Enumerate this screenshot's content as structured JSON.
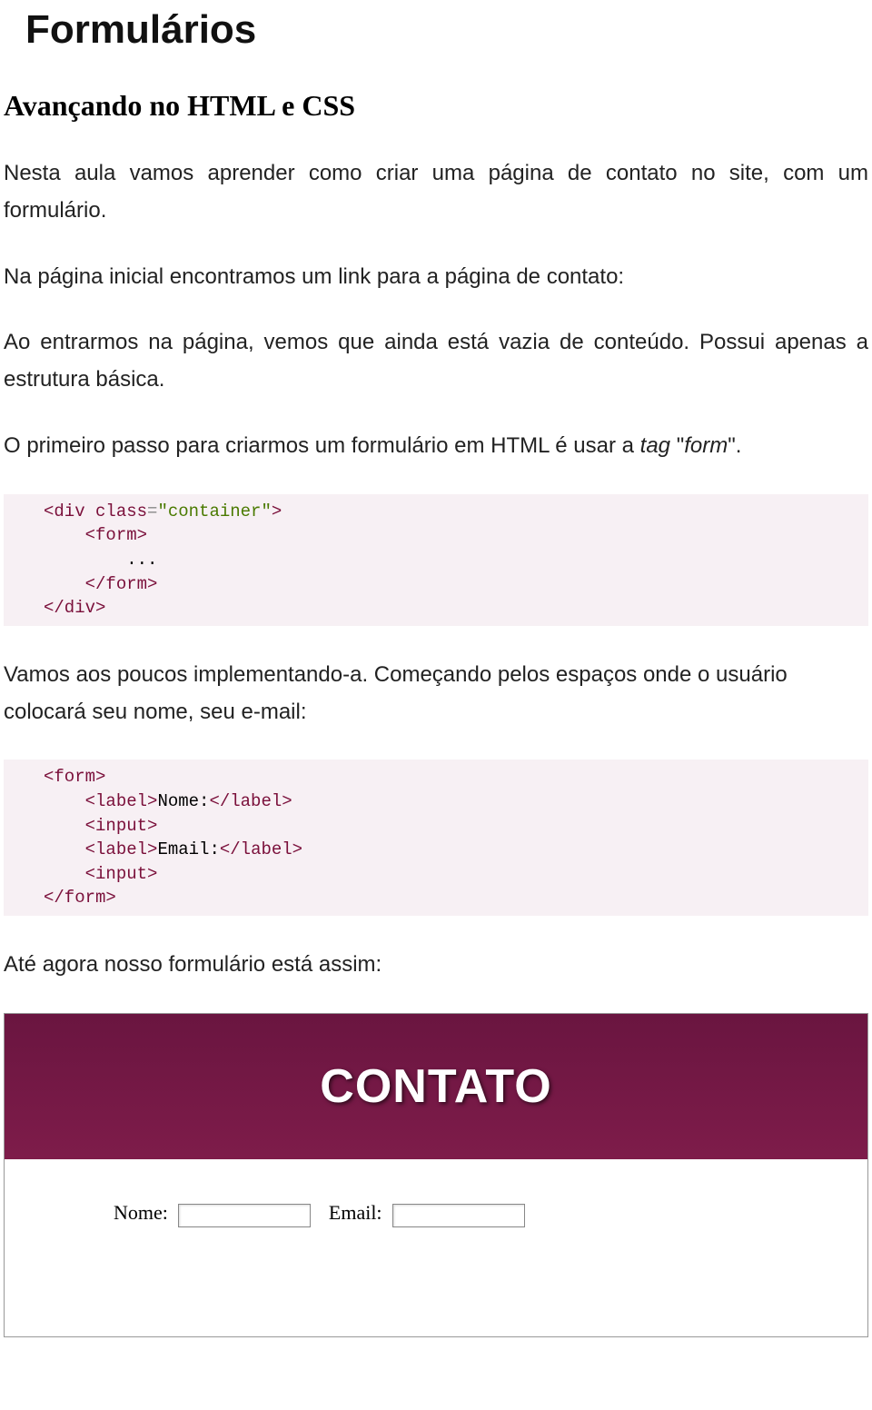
{
  "title": "Formulários",
  "subtitle": "Avançando no HTML e CSS",
  "para1": "Nesta aula vamos aprender como criar uma página de contato no site, com um formulário.",
  "para2": "Na página inicial encontramos um link para a página de contato:",
  "para3": "Ao entrarmos na página, vemos que ainda está vazia de conteúdo. Possui apenas a estrutura básica.",
  "para4_pre": "O primeiro passo para criarmos um formulário em HTML é usar a ",
  "para4_tag": "tag",
  "para4_quote": " \"",
  "para4_form": "form",
  "para4_post": "\".",
  "code1": {
    "l1_open": "<div ",
    "l1_attr": "class",
    "l1_eq": "=",
    "l1_str": "\"container\"",
    "l1_close": ">",
    "l2": "<form>",
    "l3": "...",
    "l4": "</form>",
    "l5": "</div>"
  },
  "para5": "Vamos aos poucos implementando-a. Começando pelos espaços onde o usuário colocará seu nome, seu e-mail:",
  "code2": {
    "l1": "<form>",
    "l2_open": "<label>",
    "l2_text": "Nome:",
    "l2_close": "</label>",
    "l3": "<input>",
    "l4_open": "<label>",
    "l4_text": "Email:",
    "l4_close": "</label>",
    "l5": "<input>",
    "l6": "</form>"
  },
  "para6": "Até agora nosso formulário está assim:",
  "preview": {
    "header": "CONTATO",
    "nome_label": "Nome:",
    "email_label": "Email:"
  }
}
